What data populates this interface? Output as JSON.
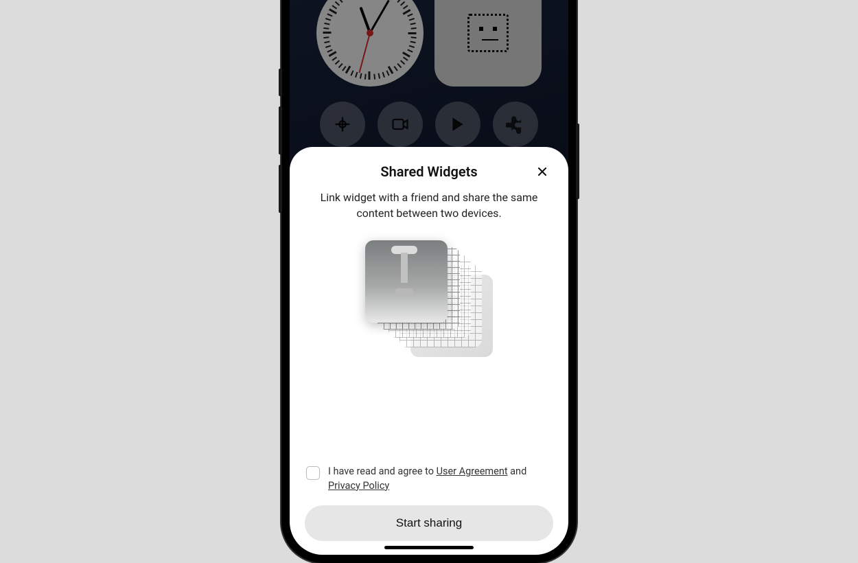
{
  "sheet": {
    "title": "Shared Widgets",
    "subtitle": "Link widget with a friend and share the same content between two devices.",
    "consent_prefix": "I have read and agree to ",
    "user_agreement": "User Agreement",
    "and": " and ",
    "privacy_policy": "Privacy Policy",
    "start_label": "Start sharing"
  },
  "background_icons": [
    "photos-icon",
    "camera-icon",
    "play-store-icon",
    "puzzle-icon"
  ]
}
